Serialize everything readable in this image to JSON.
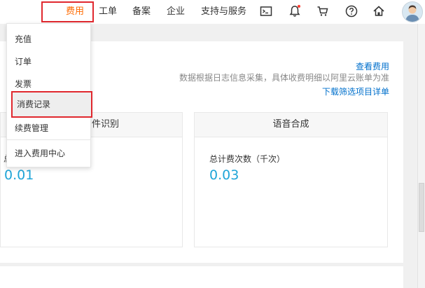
{
  "nav": {
    "fee": "费用",
    "ticket": "工单",
    "filing": "备案",
    "enterprise": "企业",
    "support": "支持与服务",
    "icons": [
      "terminal-icon",
      "bell-icon",
      "cart-icon",
      "help-icon",
      "home-icon",
      "avatar"
    ]
  },
  "dropdown": {
    "items": [
      "充值",
      "订单",
      "发票",
      "消费记录",
      "续费管理"
    ],
    "selected": "消费记录",
    "footer": "进入费用中心"
  },
  "panel": {
    "view_fee_link": "查看费用",
    "note": "数据根据日志信息采集，具体收费明细以阿里云账单为准",
    "download_link": "下载筛选项目详单"
  },
  "cards": [
    {
      "title": "件识别",
      "label": "总",
      "value": "0.01"
    },
    {
      "title": "语音合成",
      "label": "总计费次数（千次）",
      "value": "0.03"
    }
  ],
  "colors": {
    "accent_orange": "#ff6a00",
    "highlight_red": "#e0282e",
    "value_blue": "#1fa5d8",
    "link_blue": "#0070cc"
  }
}
